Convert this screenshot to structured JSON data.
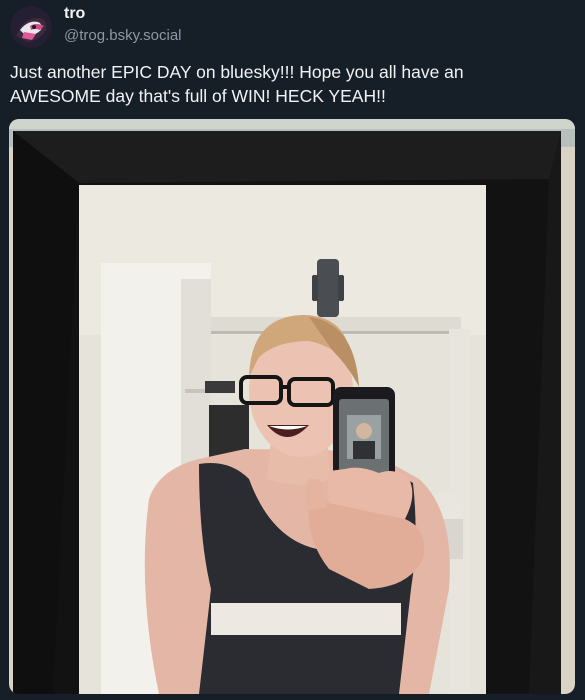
{
  "author": {
    "display_name": "tro",
    "handle": "@trog.bsky.social",
    "avatar_icon": "avatar-image"
  },
  "post": {
    "text_line1": "Just another EPIC DAY on bluesky!!! Hope you all have an",
    "text_line2": "AWESOME day that's full of WIN! HECK YEAH!!"
  },
  "media": {
    "kind": "photo",
    "icon": "photo-mirror-selfie-image"
  },
  "colors": {
    "background": "#161e27",
    "text": "#f1f3f5",
    "handle": "#8b98a5"
  }
}
